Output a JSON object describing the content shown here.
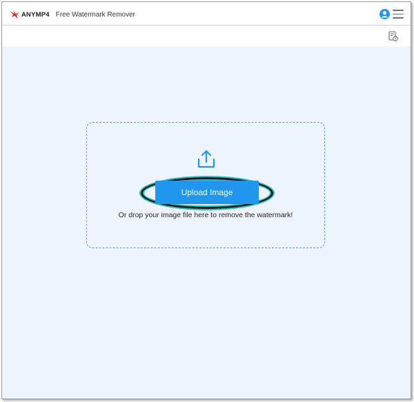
{
  "header": {
    "brand": "ANYMP4",
    "title": "Free Watermark Remover"
  },
  "icons": {
    "logo": "anymp4-bird-logo",
    "account": "user-account-icon",
    "menu": "hamburger-menu-icon",
    "history": "history-document-icon",
    "upload": "upload-icon"
  },
  "upload": {
    "button_label": "Upload Image",
    "hint": "Or drop your image file here to remove the watermark!"
  },
  "colors": {
    "accent": "#2196ee",
    "logo_red": "#e0322a",
    "dropzone_border": "#4a9fd8",
    "background": "#eef4fd",
    "highlight_ring": "#29c1c1"
  }
}
